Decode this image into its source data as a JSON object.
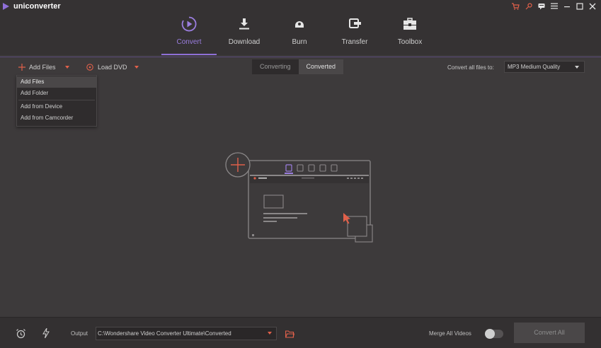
{
  "app": {
    "title": "uniconverter"
  },
  "nav": {
    "items": [
      {
        "label": "Convert",
        "icon": "play-circle-icon"
      },
      {
        "label": "Download",
        "icon": "download-icon"
      },
      {
        "label": "Burn",
        "icon": "disc-icon"
      },
      {
        "label": "Transfer",
        "icon": "transfer-icon"
      },
      {
        "label": "Toolbox",
        "icon": "toolbox-icon"
      }
    ],
    "active": "Convert"
  },
  "toolbar": {
    "add_files": "Add Files",
    "load_dvd": "Load DVD",
    "tabs": [
      "Converting",
      "Converted"
    ],
    "active_tab": "Converted",
    "convert_all_label": "Convert all files to:",
    "quality": "MP3 Medium Quality"
  },
  "add_menu": {
    "items": [
      "Add Files",
      "Add Folder",
      "Add from Device",
      "Add from Camcorder"
    ],
    "highlighted": "Add Files"
  },
  "footer": {
    "output_label": "Output",
    "output_path": "C:\\Wondershare Video Converter Ultimate\\Converted",
    "merge_label": "Merge All Videos",
    "merge_on": false,
    "convert_all": "Convert All"
  },
  "colors": {
    "accent": "#8e6fd6",
    "orange": "#e0604a",
    "bg": "#3d3a3b"
  }
}
